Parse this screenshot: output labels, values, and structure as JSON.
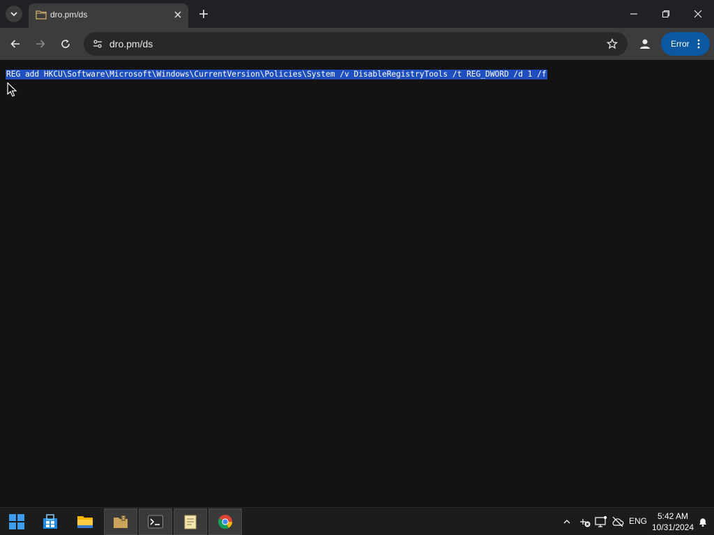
{
  "browser": {
    "tab": {
      "title": "dro.pm/ds"
    },
    "address_bar": {
      "url": "dro.pm/ds"
    },
    "error_button": {
      "label": "Error"
    }
  },
  "page": {
    "command_text": "REG add HKCU\\Software\\Microsoft\\Windows\\CurrentVersion\\Policies\\System /v DisableRegistryTools /t REG_DWORD /d 1 /f"
  },
  "taskbar": {
    "language": "ENG",
    "time": "5:42 AM",
    "date": "10/31/2024"
  },
  "colors": {
    "selection": "#1f4fbf",
    "error_button": "#0b57a0"
  }
}
